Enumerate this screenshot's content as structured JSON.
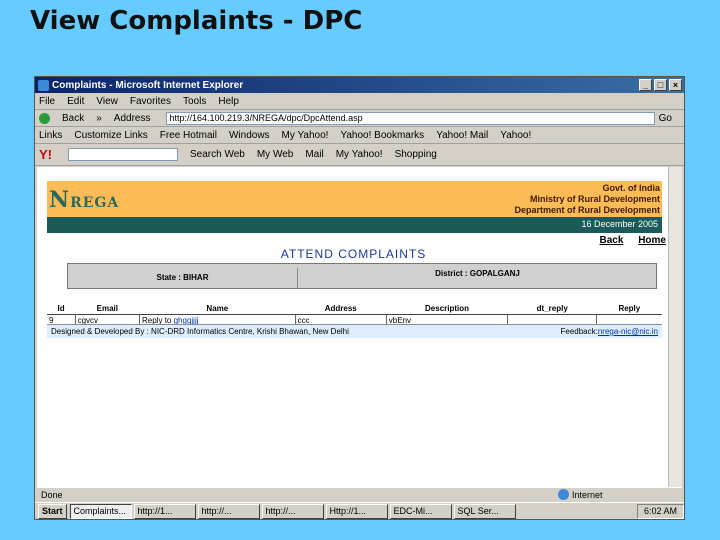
{
  "slide_title": "View Complaints - DPC",
  "window": {
    "title": "Complaints - Microsoft Internet Explorer",
    "minimize": "_",
    "maximize": "□",
    "close": "×"
  },
  "menu": [
    "File",
    "Edit",
    "View",
    "Favorites",
    "Tools",
    "Help"
  ],
  "toolbar": {
    "back": "Back",
    "chevron": "»",
    "address_label": "Address",
    "url": "http://164.100.219.3/NREGA/dpc/DpcAttend.asp",
    "go": "Go"
  },
  "links_bar": [
    "Links",
    "Customize Links",
    "Free Hotmail",
    "Windows",
    "My Yahoo!",
    "Yahoo! Bookmarks",
    "Yahoo! Mail",
    "Yahoo!"
  ],
  "yahoo_bar": {
    "search_button": "Search Web",
    "items": [
      "My Web",
      "Mail",
      "My Yahoo!",
      "Shopping"
    ]
  },
  "page": {
    "logo_n": "N",
    "logo_rega": "REGA",
    "govt": [
      "Govt. of India",
      "Ministry of Rural Development",
      "Department of Rural Development"
    ],
    "date": "16 December 2005",
    "back": "Back",
    "home": "Home",
    "heading": "ATTEND COMPLAINTS",
    "state": "State : BIHAR",
    "district": "District : GOPALGANJ",
    "columns": [
      "Id",
      "Email",
      "Name",
      "Address",
      "Description",
      "dt_reply",
      "Reply"
    ],
    "rows": [
      [
        "9",
        "cgvcv",
        "Reply to",
        "ghggjjjj",
        "ccc",
        "vbEnv",
        "",
        ""
      ]
    ],
    "footer_text": "Designed & Developed By : NIC-DRD Informatics Centre, Krishi Bhawan, New Delhi",
    "feedback_label": "Feedback:",
    "feedback_email": "nrega-nic@nic.in"
  },
  "statusbar": {
    "left": "Done",
    "right": "Internet"
  },
  "taskbar": {
    "start": "Start",
    "tasks": [
      "Complaints...",
      "http://1...",
      "http://...",
      "http://...",
      "Http://1...",
      "EDC-Mi...",
      "SQL Ser..."
    ],
    "time": "6:02 AM"
  }
}
